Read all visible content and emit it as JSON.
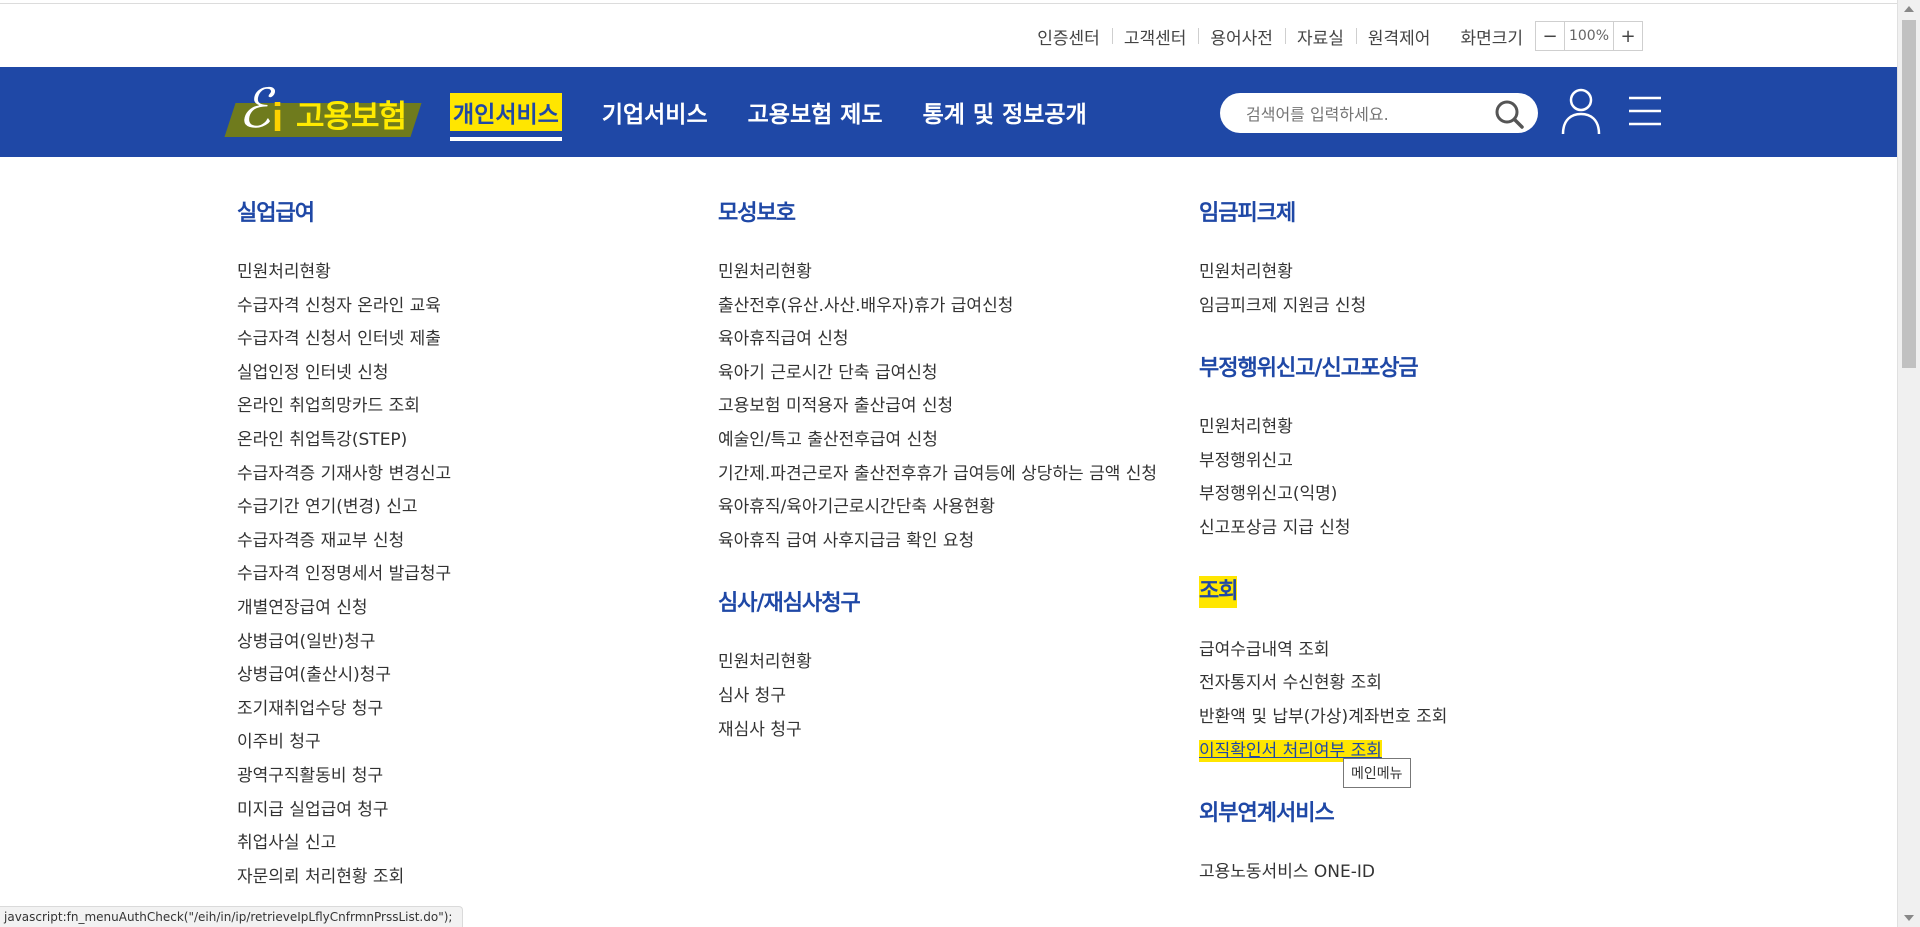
{
  "util": {
    "links": [
      "인증센터",
      "고객센터",
      "용어사전",
      "자료실",
      "원격제어"
    ],
    "zoom_label": "화면크기",
    "zoom_minus": "−",
    "zoom_value": "100%",
    "zoom_plus": "+"
  },
  "header": {
    "logo_text": "고용보험",
    "logo_e": "ℰ",
    "logo_i": "i",
    "nav": [
      "개인서비스",
      "기업서비스",
      "고용보험 제도",
      "통계 및 정보공개"
    ],
    "active_nav": "개인서비스",
    "search_placeholder": "검색어를 입력하세요.",
    "colors": {
      "brand_blue": "#1f48a6",
      "highlight": "#ffe600"
    }
  },
  "menu": {
    "col1": {
      "title": "실업급여",
      "items": [
        "민원처리현황",
        "수급자격 신청자 온라인 교육",
        "수급자격 신청서 인터넷 제출",
        "실업인정 인터넷 신청",
        "온라인 취업희망카드 조회",
        "온라인 취업특강(STEP)",
        "수급자격증 기재사항 변경신고",
        "수급기간 연기(변경) 신고",
        "수급자격증 재교부 신청",
        "수급자격 인정명세서 발급청구",
        "개별연장급여 신청",
        "상병급여(일반)청구",
        "상병급여(출산시)청구",
        "조기재취업수당 청구",
        "이주비 청구",
        "광역구직활동비 청구",
        "미지급 실업급여 청구",
        "취업사실 신고",
        "자문의뢰 처리현황 조회"
      ]
    },
    "col2": {
      "group1_title": "모성보호",
      "group1_items": [
        "민원처리현황",
        "출산전후(유산.사산.배우자)휴가 급여신청",
        "육아휴직급여 신청",
        "육아기 근로시간 단축 급여신청",
        "고용보험 미적용자 출산급여 신청",
        "예술인/특고 출산전후급여 신청",
        "기간제.파견근로자 출산전후휴가 급여등에 상당하는 금액 신청",
        "육아휴직/육아기근로시간단축 사용현황",
        "육아휴직 급여 사후지급금 확인 요청"
      ],
      "group2_title": "심사/재심사청구",
      "group2_items": [
        "민원처리현황",
        "심사 청구",
        "재심사 청구"
      ]
    },
    "col3": {
      "group1_title": "임금피크제",
      "group1_items": [
        "민원처리현황",
        "임금피크제 지원금 신청"
      ],
      "group2_title": "부정행위신고/신고포상금",
      "group2_items": [
        "민원처리현황",
        "부정행위신고",
        "부정행위신고(익명)",
        "신고포상금 지급 신청"
      ],
      "group3_title": "조회",
      "group3_items": [
        "급여수급내역 조회",
        "전자통지서 수신현황 조회",
        "반환액 및 납부(가상)계좌번호 조회",
        "이직확인서 처리여부 조회"
      ],
      "group4_title": "외부연계서비스",
      "group4_items": [
        "고용노동서비스 ONE-ID"
      ]
    }
  },
  "tooltip": "메인메뉴",
  "statusbar": "javascript:fn_menuAuthCheck(\"/eih/in/ip/retrieveIpLflyCnfrmnPrssList.do\");"
}
